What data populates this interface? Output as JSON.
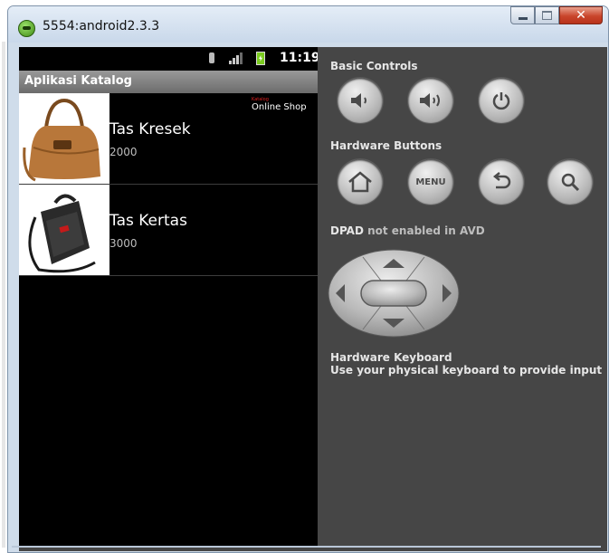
{
  "window": {
    "title": "5554:android2.3.3"
  },
  "statusbar": {
    "time": "11:19"
  },
  "app": {
    "title": "Aplikasi Katalog",
    "brand_small": "Katalog",
    "brand_big": "Online Shop"
  },
  "items": [
    {
      "name": "Tas Kresek",
      "price": "2000"
    },
    {
      "name": "Tas Kertas",
      "price": "3000"
    }
  ],
  "panel": {
    "basic_controls": "Basic Controls",
    "hardware_buttons": "Hardware Buttons",
    "menu_label": "MENU",
    "dpad_label": "DPAD",
    "dpad_note": "not enabled in AVD",
    "keyboard_title": "Hardware Keyboard",
    "keyboard_hint": "Use your physical keyboard to provide input"
  },
  "icons": {
    "basic": [
      "volume-down-icon",
      "volume-up-icon",
      "power-icon"
    ],
    "hardware": [
      "home-icon",
      "menu-button",
      "back-icon",
      "search-icon"
    ]
  }
}
